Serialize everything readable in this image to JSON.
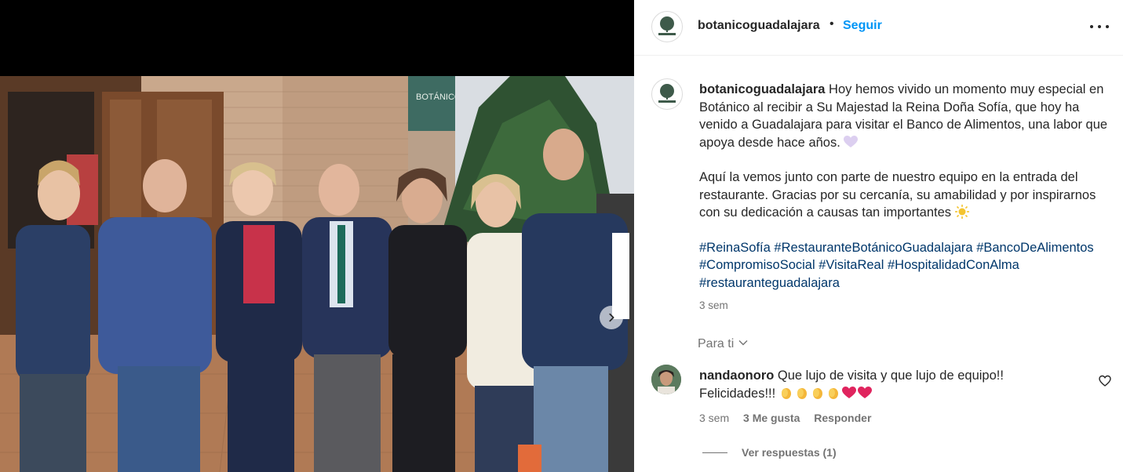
{
  "post": {
    "username": "botanicoguadalajara",
    "follow_label": "Seguir",
    "bullet": "•",
    "caption_p1": " Hoy hemos vivido un momento muy especial en Botánico al recibir a Su Majestad la Reina Doña Sofía, que hoy ha venido a Guadalajara para visitar el Banco de Alimentos, una labor que apoya desde hace años. ",
    "caption_p2": "Aquí la vemos junto con parte de nuestro equipo en la entrada del restaurante. Gracias por su cercanía, su amabilidad y por inspirarnos con su dedicación a causas tan importantes ",
    "hashtags": [
      "#ReinaSofía",
      "#RestauranteBotánicoGuadalajara",
      "#BancoDeAlimentos",
      "#CompromisoSocial",
      "#VisitaReal",
      "#HospitalidadConAlma",
      "#restauranteguadalajara"
    ],
    "time": "3 sem",
    "photo_sign": "BOTÁNICO"
  },
  "for_you": "Para ti",
  "comment": {
    "username": "nandaonoro",
    "text": " Que lujo de visita y que lujo de equipo!!",
    "text2": "Felicidades!!!",
    "emojis": [
      "clap",
      "clap",
      "clap",
      "clap",
      "heart",
      "heart"
    ],
    "time": "3 sem",
    "likes": "3 Me gusta",
    "reply": "Responder",
    "view_replies": "Ver respuestas (1)"
  },
  "colors": {
    "link": "#0095f6",
    "hashtag": "#00376b",
    "muted": "#737373",
    "text": "#262626"
  },
  "icons": [
    "chevron-right-icon",
    "more-options-icon",
    "chevron-down-icon",
    "heart-outline-icon",
    "botanico-logo"
  ]
}
